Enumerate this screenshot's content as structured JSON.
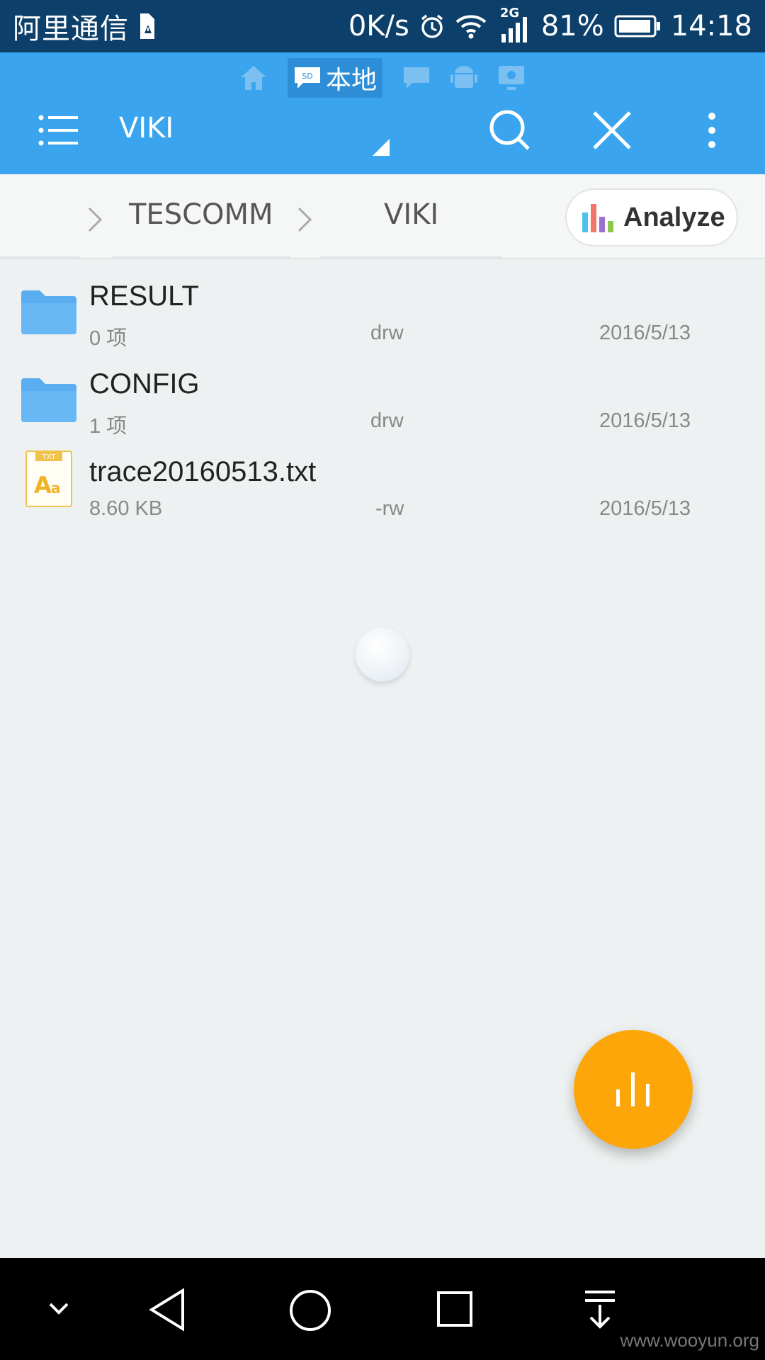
{
  "status_bar": {
    "carrier": "阿里通信",
    "net_speed": "0K/s",
    "network_type": "2G",
    "battery": "81%",
    "time": "14:18"
  },
  "app_bar": {
    "location_tab_active": "本地",
    "title": "VIKI",
    "colors": {
      "primary": "#3aa5ee",
      "status": "#0c3f6a"
    }
  },
  "breadcrumb": {
    "items": [
      "TESCOMM",
      "VIKI"
    ],
    "analyze_label": "Analyze"
  },
  "files": [
    {
      "name": "RESULT",
      "info": "0 项",
      "perm": "drw",
      "date": "2016/5/13",
      "type": "folder"
    },
    {
      "name": "CONFIG",
      "info": "1 项",
      "perm": "drw",
      "date": "2016/5/13",
      "type": "folder"
    },
    {
      "name": "trace20160513.txt",
      "info": "8.60 KB",
      "perm": "-rw",
      "date": "2016/5/13",
      "type": "txt"
    }
  ],
  "txt_icon_label": "TXT",
  "fab": {
    "color": "#fda60a"
  },
  "watermark": "www.wooyun.org"
}
